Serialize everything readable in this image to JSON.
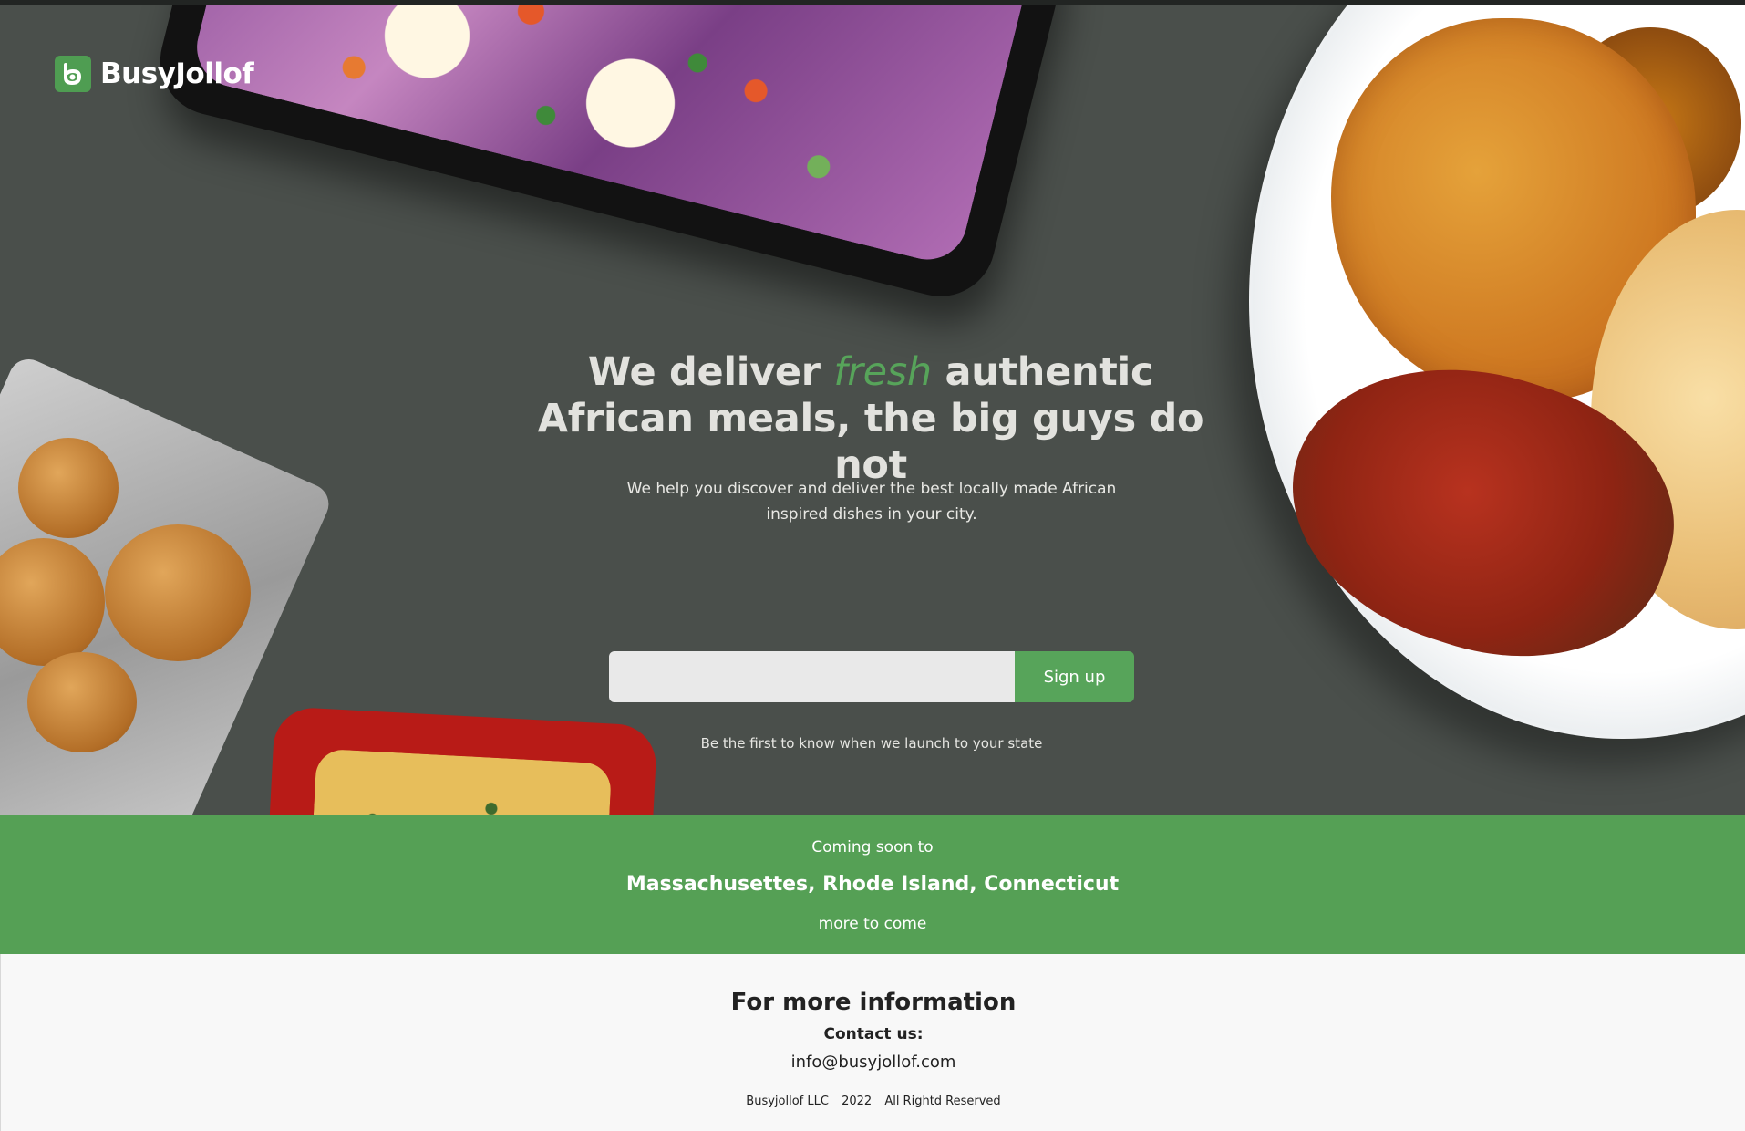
{
  "brand": {
    "name": "BusyJollof",
    "logo_icon": "busyjollof-logo-icon",
    "color": "#4f9d52"
  },
  "hero": {
    "headline_before": "We deliver",
    "headline_accent": "fresh",
    "headline_after": "authentic African meals, the big guys do not",
    "subhead": "We help you discover and deliver the best locally made African inspired dishes in your city.",
    "email_value": "",
    "signup_label": "Sign up",
    "signup_note": "Be the first to know when we launch to your state",
    "background_color": "#4a4f4b",
    "accent_color": "#57a45a"
  },
  "banner": {
    "intro": "Coming soon to",
    "states": "Massachusettes, Rhode Island, Connecticut",
    "more": "more to come",
    "background_color": "#55a055"
  },
  "footer": {
    "title": "For more information",
    "contact_label": "Contact us:",
    "email": "info@busyjollof.com",
    "company": "Busyjollof LLC",
    "year": "2022",
    "rights": "All Rightd Reserved"
  }
}
